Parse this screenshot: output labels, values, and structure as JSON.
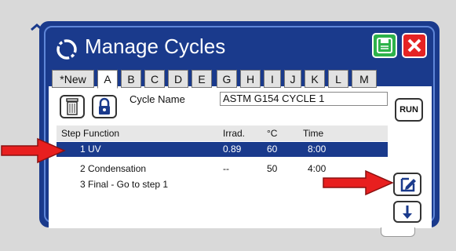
{
  "dialog": {
    "title": "Manage Cycles",
    "save_icon": "save-icon",
    "close_icon": "close-icon",
    "accent": "#1a3a8c"
  },
  "tabs": [
    "*New",
    "A",
    "B",
    "C",
    "D",
    "E",
    "G",
    "H",
    "I",
    "J",
    "K",
    "L",
    "M"
  ],
  "active_tab": "A",
  "toolbar": {
    "trash_icon": "trash-icon",
    "lock_icon": "lock-icon",
    "cycle_name_label": "Cycle Name",
    "cycle_name_value": "ASTM G154 CYCLE 1",
    "run_label": "RUN"
  },
  "table": {
    "headers": {
      "step_function": "Step  Function",
      "irrad": "Irrad.",
      "temp": "°C",
      "time": "Time"
    },
    "rows": [
      {
        "label": "1 UV",
        "irrad": "0.89",
        "temp": "60",
        "time": "8:00",
        "selected": true
      },
      {
        "label": "2 Condensation",
        "irrad": "--",
        "temp": "50",
        "time": "4:00",
        "selected": false
      },
      {
        "label": "3 Final - Go to step 1",
        "irrad": "",
        "temp": "",
        "time": "",
        "selected": false
      }
    ]
  },
  "side_buttons": {
    "edit_icon": "edit-icon",
    "down_icon": "arrow-down-icon"
  },
  "annotations": {
    "arrow_color": "#e81f1f"
  }
}
